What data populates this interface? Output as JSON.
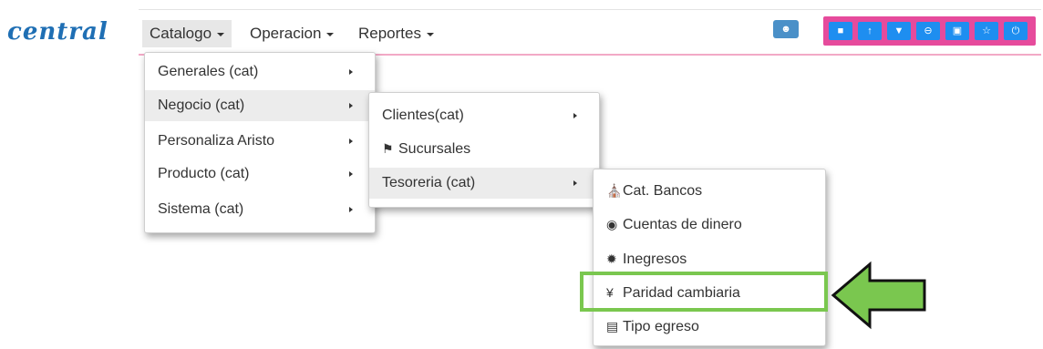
{
  "brand": "central",
  "nav": [
    {
      "label": "Catalogo"
    },
    {
      "label": "Operacion"
    },
    {
      "label": "Reportes"
    }
  ],
  "toolbar": {
    "single_icon": "user-icon",
    "icons": [
      "cube-icon",
      "upload-icon",
      "shield-icon",
      "minus-circle-icon",
      "camera-icon",
      "star-icon",
      "power-icon"
    ],
    "colors": {
      "group_bg": "#e64b9c",
      "button_bg": "#1e8ef0",
      "single_bg": "#4a90c8"
    }
  },
  "menu1": {
    "items": [
      {
        "label": "Generales (cat)"
      },
      {
        "label": "Negocio (cat)"
      },
      {
        "label": "Personaliza Aristo"
      },
      {
        "label": "Producto (cat)"
      },
      {
        "label": "Sistema (cat)"
      }
    ]
  },
  "menu2": {
    "items": [
      {
        "label": "Clientes(cat)"
      },
      {
        "label": "Sucursales",
        "icon": "flag-icon"
      },
      {
        "label": "Tesoreria (cat)"
      }
    ]
  },
  "menu3": {
    "items": [
      {
        "label": "Cat. Bancos",
        "icon": "bank-icon"
      },
      {
        "label": "Cuentas de dinero",
        "icon": "dollar-circle-icon"
      },
      {
        "label": "Inegresos",
        "icon": "cogs-icon"
      },
      {
        "label": "Paridad cambiaria",
        "icon": "yen-icon"
      },
      {
        "label": "Tipo egreso",
        "icon": "document-icon"
      }
    ]
  },
  "highlight_color": "#7ac74f"
}
